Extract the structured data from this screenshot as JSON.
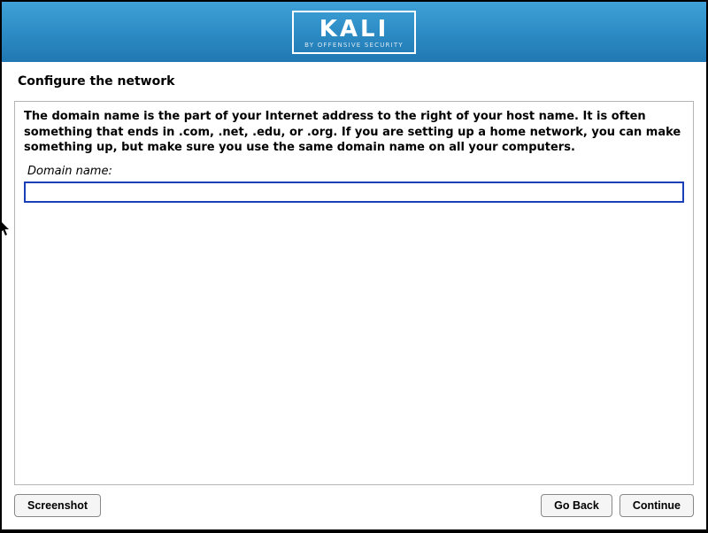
{
  "header": {
    "logo": "KALI",
    "logo_sub": "BY OFFENSIVE SECURITY"
  },
  "page": {
    "title": "Configure the network",
    "description": "The domain name is the part of your Internet address to the right of your host name.  It is often something that ends in .com, .net, .edu, or .org.  If you are setting up a home network, you can make something up, but make sure you use the same domain name on all your computers.",
    "field_label": "Domain name:",
    "domain_value": ""
  },
  "buttons": {
    "screenshot": "Screenshot",
    "go_back": "Go Back",
    "continue": "Continue"
  }
}
